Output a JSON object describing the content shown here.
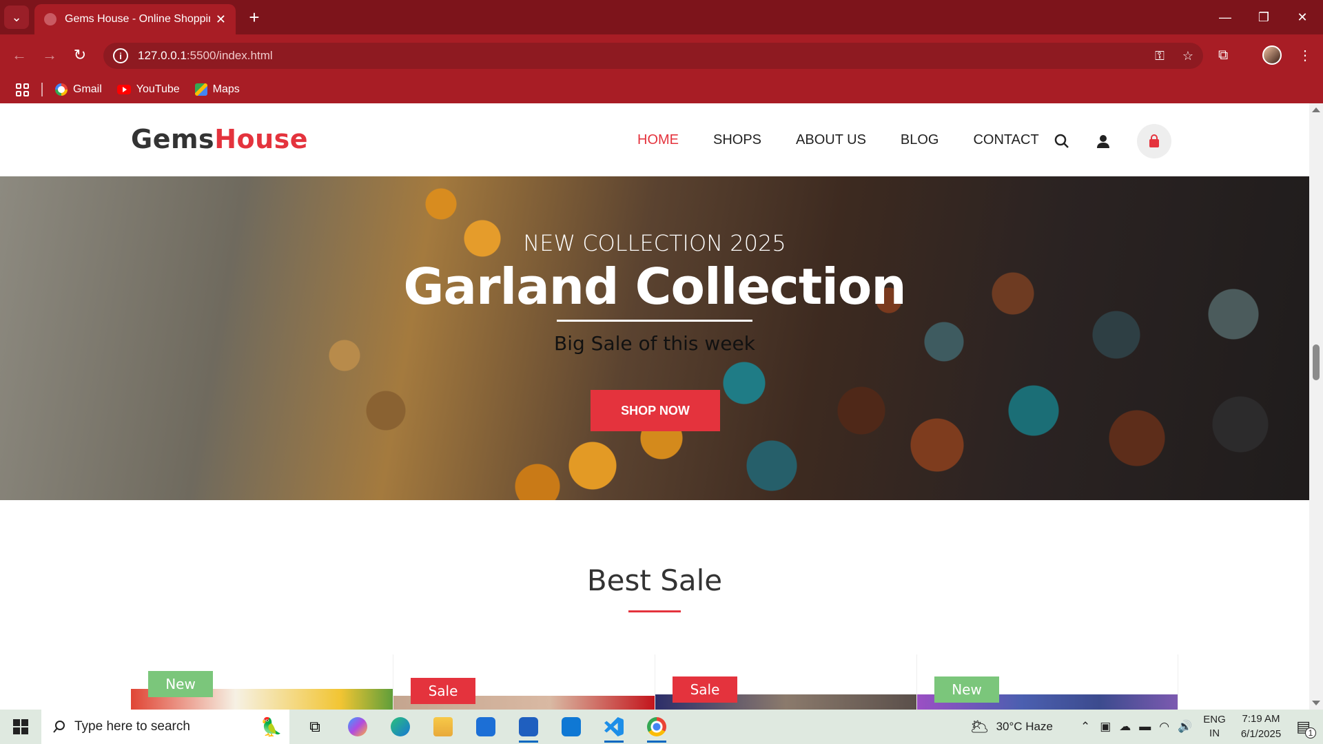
{
  "browser": {
    "tab_title": "Gems House - Online Shopping",
    "url_host": "127.0.0.1",
    "url_rest": ":5500/index.html",
    "bookmarks": [
      "Gmail",
      "YouTube",
      "Maps"
    ]
  },
  "site": {
    "logo_part1": "Gems",
    "logo_part2": "House",
    "nav": [
      "HOME",
      "SHOPS",
      "ABOUT US",
      "BLOG",
      "CONTACT"
    ],
    "active_nav": "HOME"
  },
  "hero": {
    "subtitle": "NEW COLLECTION 2025",
    "title": "Garland Collection",
    "tagline": "Big Sale of this week",
    "button": "SHOP NOW"
  },
  "best_sale": {
    "title": "Best Sale",
    "badges": [
      "New",
      "Sale",
      "Sale",
      "New"
    ]
  },
  "taskbar": {
    "search_placeholder": "Type here to search",
    "weather": "30°C  Haze",
    "lang_1": "ENG",
    "lang_2": "IN",
    "time": "7:19 AM",
    "date": "6/1/2025",
    "notification_count": "1"
  },
  "colors": {
    "brand_red": "#e4333d",
    "chrome_dark": "#7d141b",
    "chrome_toolbar": "#a81d25",
    "badge_new": "#7bc67b"
  }
}
